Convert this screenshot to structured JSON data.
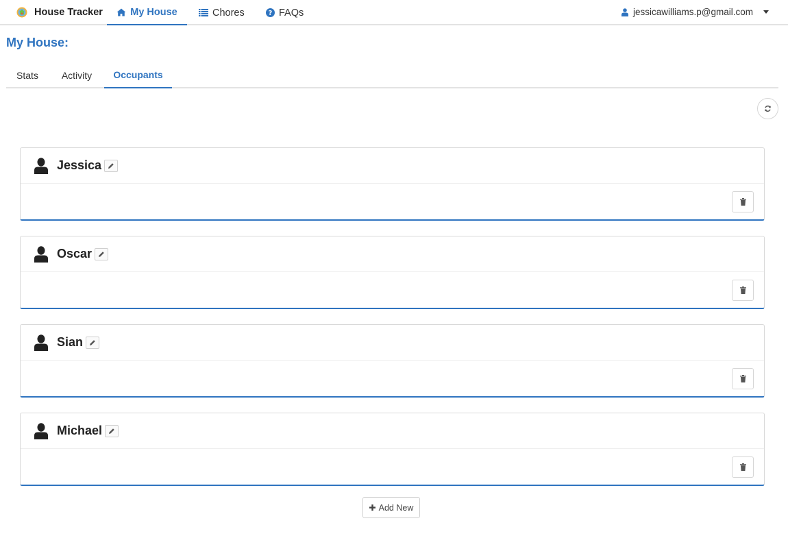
{
  "app": {
    "brand": "House Tracker",
    "accent_color": "#2f74c0"
  },
  "nav": {
    "my_house": "My House",
    "chores": "Chores",
    "faqs": "FAQs",
    "user_email": "jessicawilliams.p@gmail.com"
  },
  "page": {
    "title": "My House:"
  },
  "tabs": {
    "stats": "Stats",
    "activity": "Activity",
    "occupants": "Occupants",
    "active": "Occupants"
  },
  "occupants": [
    {
      "name": "Jessica"
    },
    {
      "name": "Oscar"
    },
    {
      "name": "Sian"
    },
    {
      "name": "Michael"
    }
  ],
  "actions": {
    "add_new": "Add New"
  },
  "icons": {
    "brand": "house-logo-icon",
    "my_house": "home-icon",
    "chores": "list-icon",
    "faqs": "question-circle-icon",
    "user": "user-icon",
    "refresh": "refresh-icon",
    "occupant": "person-icon",
    "edit": "pencil-icon",
    "delete": "trash-icon",
    "add": "plus-icon"
  }
}
